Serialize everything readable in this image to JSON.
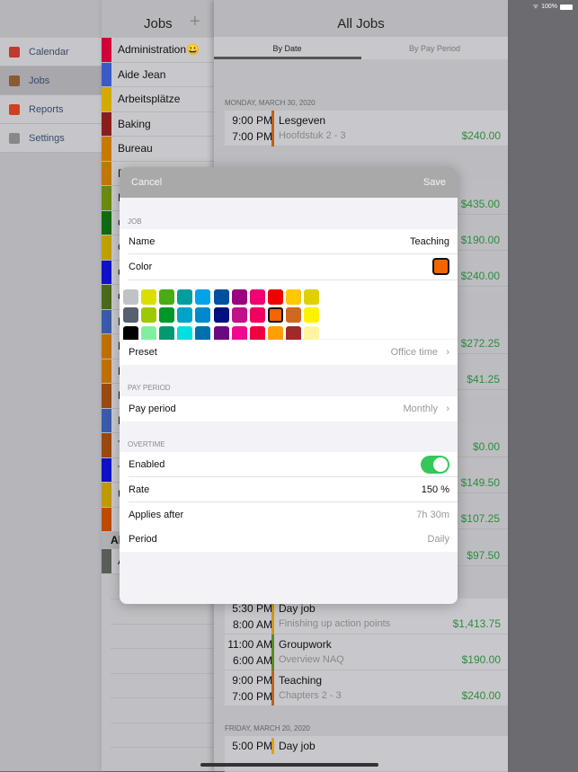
{
  "status_bar": {
    "battery": "100%"
  },
  "sidebar": {
    "items": [
      {
        "label": "Calendar",
        "icon": "calendar-icon",
        "color": "#c0392b",
        "selected": false
      },
      {
        "label": "Jobs",
        "icon": "briefcase-icon",
        "color": "#8a5a30",
        "selected": true
      },
      {
        "label": "Reports",
        "icon": "bar-chart-icon",
        "color": "#d04020",
        "selected": false
      },
      {
        "label": "Settings",
        "icon": "gear-icon",
        "color": "#888888",
        "selected": false
      }
    ]
  },
  "jobs_panel": {
    "title": "Jobs",
    "add_icon": "+",
    "items": [
      {
        "label": "Administration😀",
        "color": "#d0003a"
      },
      {
        "label": "Aide Jean",
        "color": "#3a5ac8"
      },
      {
        "label": "Arbeitsplätze",
        "color": "#d4aa00"
      },
      {
        "label": "Baking",
        "color": "#8a1e1e"
      },
      {
        "label": "Bureau",
        "color": "#c87a00"
      },
      {
        "label": "D",
        "color": "#c07800"
      },
      {
        "label": "F",
        "color": "#6a8a10"
      },
      {
        "label": "G",
        "color": "#116a10"
      },
      {
        "label": "G",
        "color": "#c0a000"
      },
      {
        "label": "G",
        "color": "#1010c8"
      },
      {
        "label": "G",
        "color": "#4a6a18"
      },
      {
        "label": "H",
        "color": "#3a5aaa"
      },
      {
        "label": "H",
        "color": "#c07000"
      },
      {
        "label": "H",
        "color": "#c07000"
      },
      {
        "label": "L",
        "color": "#9a4a10"
      },
      {
        "label": "N",
        "color": "#3a5aaa"
      },
      {
        "label": "T",
        "color": "#9a4a10"
      },
      {
        "label": "T",
        "color": "#1010c8"
      },
      {
        "label": "U",
        "color": "#c09a00"
      },
      {
        "label": "",
        "color": "#c04a00"
      }
    ],
    "archive_header": "Al",
    "archive_items": [
      {
        "label": "A",
        "color": "#5a5e58"
      }
    ]
  },
  "main": {
    "title": "All Jobs",
    "tabs": [
      {
        "label": "By Date",
        "active": true
      },
      {
        "label": "By Pay Period",
        "active": false
      }
    ],
    "day1": "MONDAY, MARCH 30, 2020",
    "entry1": {
      "end": "9:00 PM",
      "start": "7:00 PM",
      "title": "Lesgeven",
      "subtitle": "Hoofdstuk 2 - 3",
      "amount": "$240.00",
      "color": "#c06010"
    },
    "hidden_amounts": [
      "$435.00",
      "$190.00",
      "$240.00",
      "$272.25",
      "$41.25",
      "$0.00",
      "$149.50",
      "$107.25",
      "$97.50"
    ],
    "entries": [
      {
        "end": "5:30 PM",
        "start": "8:00 AM",
        "title": "Day job",
        "subtitle": "Finishing up action points",
        "amount": "$1,413.75",
        "color": "#d09a10"
      },
      {
        "end": "11:00 AM",
        "start": "6:00 AM",
        "title": "Groupwork",
        "subtitle": "Overview NAQ",
        "amount": "$190.00",
        "color": "#5a8a20"
      },
      {
        "end": "9:00 PM",
        "start": "7:00 PM",
        "title": "Teaching",
        "subtitle": "Chapters 2 - 3",
        "amount": "$240.00",
        "color": "#c06020"
      }
    ],
    "day2": "FRIDAY, MARCH 20, 2020",
    "entry_last": {
      "end": "5:00 PM",
      "title": "Day job",
      "color": "#e0a010"
    }
  },
  "modal": {
    "cancel": "Cancel",
    "save": "Save",
    "job_section": "JOB",
    "name_label": "Name",
    "name_value": "Teaching",
    "color_label": "Color",
    "selected_color": "#f46400",
    "palette": [
      [
        "#bfc3c5",
        "#d9e000",
        "#4aac14",
        "#009e9e",
        "#00a3e8",
        "#0050a0",
        "#9a0080",
        "#f00070",
        "#f00000",
        "#ffc800",
        "#e0d000"
      ],
      [
        "#56606e",
        "#a0c800",
        "#009628",
        "#00a3c8",
        "#0088cc",
        "#001080",
        "#c0108a",
        "#f00060",
        "#f46400",
        "#d06820",
        "#fff200"
      ],
      [
        "#000000",
        "#80f0a0",
        "#009a70",
        "#00e0e0",
        "#0070b0",
        "#6a0a80",
        "#f00a90",
        "#f00040",
        "#ffa000",
        "#a02a2a",
        "#fff5a0"
      ]
    ],
    "preset_label": "Preset",
    "preset_value": "Office time",
    "pay_section": "PAY PERIOD",
    "pay_label": "Pay period",
    "pay_value": "Monthly",
    "ot_section": "OVERTIME",
    "enabled_label": "Enabled",
    "enabled": true,
    "toggle_color": "#34c759",
    "rate_label": "Rate",
    "rate_value": "150 %",
    "applies_label": "Applies after",
    "applies_value": "7h 30m",
    "period_label": "Period",
    "period_value": "Daily"
  }
}
